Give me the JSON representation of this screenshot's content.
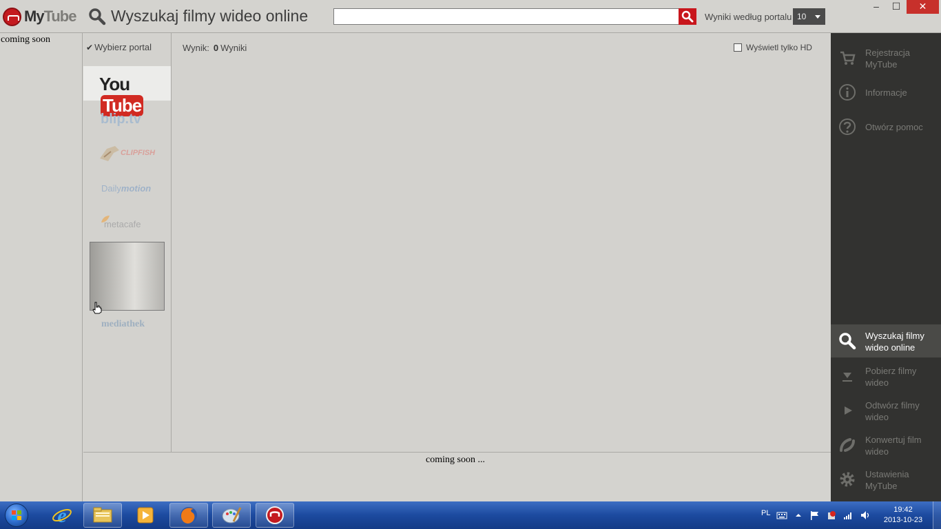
{
  "titlebar": {
    "logo_text_my": "My",
    "logo_text_tube": "Tube",
    "app_title": "Wyszukaj filmy wideo online",
    "search_value": "",
    "portal_results_label": "Wyniki według portalu",
    "results_per_portal": "10",
    "window_controls": {
      "minimize": "–",
      "maximize": "☐",
      "close": "✕"
    }
  },
  "left_column": {
    "coming_soon": "coming soon"
  },
  "portals": {
    "header": "Wybierz portal",
    "items": [
      {
        "name": "YouTube",
        "label_you": "You",
        "label_tube": "Tube",
        "selected": true
      },
      {
        "name": "blip.tv",
        "label": "blip.tv",
        "selected": false
      },
      {
        "name": "clipfish",
        "label": "CLIPFISH",
        "selected": false
      },
      {
        "name": "Dailymotion",
        "label_daily": "Daily",
        "label_motion": "motion",
        "selected": false
      },
      {
        "name": "metacafe",
        "label": "metacafe",
        "selected": false
      },
      {
        "name": "mediathek",
        "label": "mediathek",
        "selected": false
      }
    ]
  },
  "results": {
    "label": "Wynik:",
    "count": "0",
    "unit": "Wyniki",
    "hd_only_label": "Wyświetl tylko HD",
    "hd_only_checked": false
  },
  "bottom_panel": {
    "coming_soon": "coming soon ..."
  },
  "sidebar": {
    "top_items": [
      {
        "label": "Rejestracja MyTube",
        "icon": "cart-icon"
      },
      {
        "label": "Informacje",
        "icon": "info-icon"
      },
      {
        "label": "Otwórz pomoc",
        "icon": "help-icon"
      }
    ],
    "bottom_items": [
      {
        "label": "Wyszukaj filmy wideo online",
        "icon": "search-icon",
        "active": true
      },
      {
        "label": "Pobierz filmy wideo",
        "icon": "download-icon",
        "active": false
      },
      {
        "label": "Odtwórz filmy wideo",
        "icon": "play-icon",
        "active": false
      },
      {
        "label": "Konwertuj film wideo",
        "icon": "convert-icon",
        "active": false
      },
      {
        "label": "Ustawienia MyTube",
        "icon": "gear-icon",
        "active": false
      }
    ]
  },
  "taskbar": {
    "apps": [
      {
        "name": "Internet Explorer",
        "icon": "ie-icon"
      },
      {
        "name": "Windows Explorer",
        "icon": "folder-icon"
      },
      {
        "name": "Media Player",
        "icon": "media-player-icon"
      },
      {
        "name": "Firefox",
        "icon": "firefox-icon"
      },
      {
        "name": "Paint",
        "icon": "paint-icon"
      },
      {
        "name": "MyTube",
        "icon": "mytube-icon"
      }
    ],
    "language": "PL",
    "time": "19:42",
    "date": "2013-10-23"
  },
  "colors": {
    "accent_red": "#c8161c",
    "sidebar_bg": "#323230",
    "content_bg": "#d3d2ce"
  }
}
